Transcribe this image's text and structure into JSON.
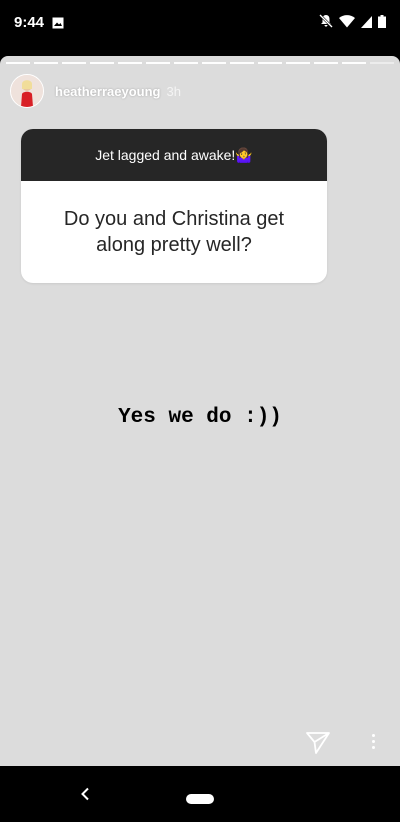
{
  "status_bar": {
    "time": "9:44",
    "icons": [
      "image-icon",
      "bell-off-icon",
      "wifi-icon",
      "signal-icon",
      "battery-icon"
    ]
  },
  "story": {
    "progress_segments_total": 14,
    "username": "heatherraeyoung",
    "time_ago": "3h",
    "question_card": {
      "header": "Jet lagged and awake!🤷‍♀️",
      "question": "Do you and Christina get along pretty well?"
    },
    "answer": "Yes we do :))",
    "background": "#dcdcdc"
  },
  "nav_bar": {
    "icons": [
      "back-icon",
      "home-pill"
    ]
  }
}
